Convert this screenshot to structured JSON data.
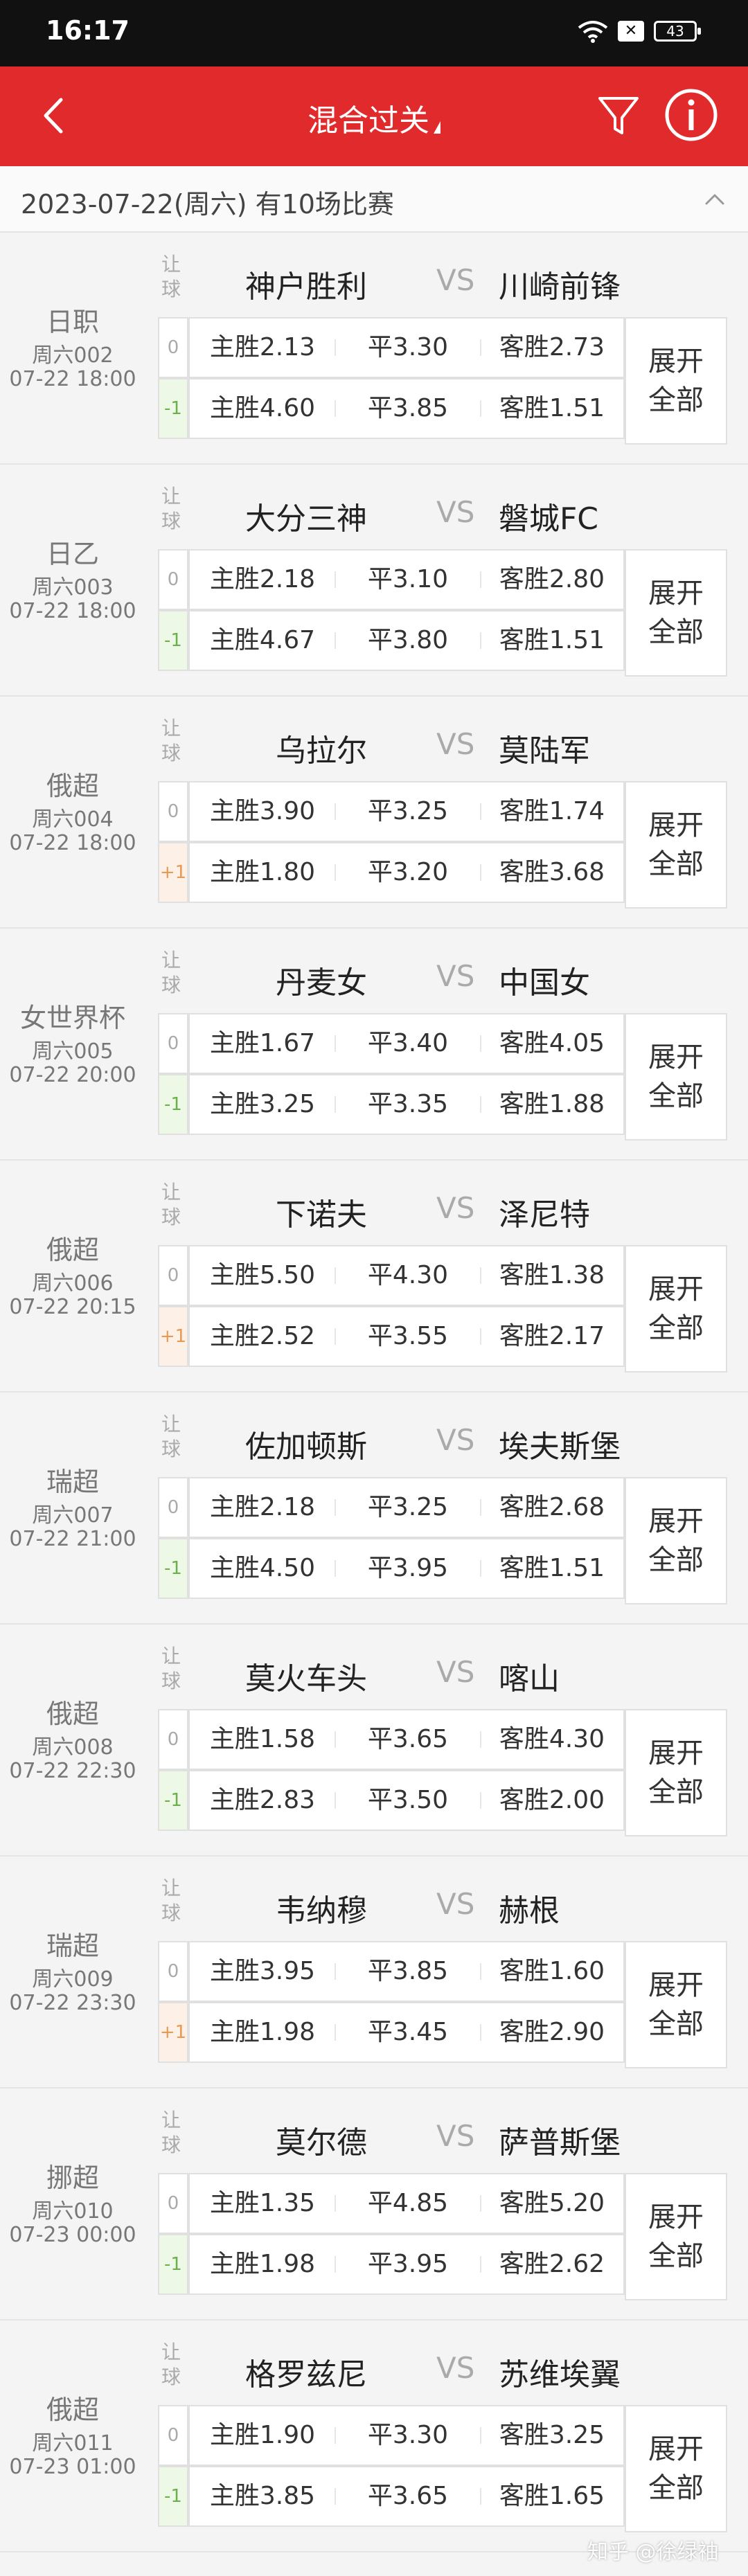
{
  "status_bar": {
    "time": "16:17",
    "sim": "✕",
    "battery": "43"
  },
  "header": {
    "title": "混合过关"
  },
  "date_bar": {
    "text": "2023-07-22(周六) 有10场比赛"
  },
  "labels": {
    "rangqiu": "让\n球",
    "vs": "VS",
    "expand": "展开\n全部"
  },
  "colors": {
    "header": "#e12a2c",
    "handicap_negative": "#6ab04c",
    "handicap_positive": "#e59a55"
  },
  "matches": [
    {
      "league": "日职",
      "num": "周六002",
      "datetime": "07-22 18:00",
      "home": "神户胜利",
      "away": "川崎前锋",
      "hcap0": "0",
      "hcap1": "-1",
      "hcap1_type": "neg",
      "r0": [
        "主胜2.13",
        "平3.30",
        "客胜2.73"
      ],
      "r1": [
        "主胜4.60",
        "平3.85",
        "客胜1.51"
      ]
    },
    {
      "league": "日乙",
      "num": "周六003",
      "datetime": "07-22 18:00",
      "home": "大分三神",
      "away": "磐城FC",
      "hcap0": "0",
      "hcap1": "-1",
      "hcap1_type": "neg",
      "r0": [
        "主胜2.18",
        "平3.10",
        "客胜2.80"
      ],
      "r1": [
        "主胜4.67",
        "平3.80",
        "客胜1.51"
      ]
    },
    {
      "league": "俄超",
      "num": "周六004",
      "datetime": "07-22 18:00",
      "home": "乌拉尔",
      "away": "莫陆军",
      "hcap0": "0",
      "hcap1": "+1",
      "hcap1_type": "pos",
      "r0": [
        "主胜3.90",
        "平3.25",
        "客胜1.74"
      ],
      "r1": [
        "主胜1.80",
        "平3.20",
        "客胜3.68"
      ]
    },
    {
      "league": "女世界杯",
      "num": "周六005",
      "datetime": "07-22 20:00",
      "home": "丹麦女",
      "away": "中国女",
      "hcap0": "0",
      "hcap1": "-1",
      "hcap1_type": "neg",
      "r0": [
        "主胜1.67",
        "平3.40",
        "客胜4.05"
      ],
      "r1": [
        "主胜3.25",
        "平3.35",
        "客胜1.88"
      ]
    },
    {
      "league": "俄超",
      "num": "周六006",
      "datetime": "07-22 20:15",
      "home": "下诺夫",
      "away": "泽尼特",
      "hcap0": "0",
      "hcap1": "+1",
      "hcap1_type": "pos",
      "r0": [
        "主胜5.50",
        "平4.30",
        "客胜1.38"
      ],
      "r1": [
        "主胜2.52",
        "平3.55",
        "客胜2.17"
      ]
    },
    {
      "league": "瑞超",
      "num": "周六007",
      "datetime": "07-22 21:00",
      "home": "佐加顿斯",
      "away": "埃夫斯堡",
      "hcap0": "0",
      "hcap1": "-1",
      "hcap1_type": "neg",
      "r0": [
        "主胜2.18",
        "平3.25",
        "客胜2.68"
      ],
      "r1": [
        "主胜4.50",
        "平3.95",
        "客胜1.51"
      ]
    },
    {
      "league": "俄超",
      "num": "周六008",
      "datetime": "07-22 22:30",
      "home": "莫火车头",
      "away": "喀山",
      "hcap0": "0",
      "hcap1": "-1",
      "hcap1_type": "neg",
      "r0": [
        "主胜1.58",
        "平3.65",
        "客胜4.30"
      ],
      "r1": [
        "主胜2.83",
        "平3.50",
        "客胜2.00"
      ]
    },
    {
      "league": "瑞超",
      "num": "周六009",
      "datetime": "07-22 23:30",
      "home": "韦纳穆",
      "away": "赫根",
      "hcap0": "0",
      "hcap1": "+1",
      "hcap1_type": "pos",
      "r0": [
        "主胜3.95",
        "平3.85",
        "客胜1.60"
      ],
      "r1": [
        "主胜1.98",
        "平3.45",
        "客胜2.90"
      ]
    },
    {
      "league": "挪超",
      "num": "周六010",
      "datetime": "07-23 00:00",
      "home": "莫尔德",
      "away": "萨普斯堡",
      "hcap0": "0",
      "hcap1": "-1",
      "hcap1_type": "neg",
      "r0": [
        "主胜1.35",
        "平4.85",
        "客胜5.20"
      ],
      "r1": [
        "主胜1.98",
        "平3.95",
        "客胜2.62"
      ]
    },
    {
      "league": "俄超",
      "num": "周六011",
      "datetime": "07-23 01:00",
      "home": "格罗兹尼",
      "away": "苏维埃翼",
      "hcap0": "0",
      "hcap1": "-1",
      "hcap1_type": "neg",
      "r0": [
        "主胜1.90",
        "平3.30",
        "客胜3.25"
      ],
      "r1": [
        "主胜3.85",
        "平3.65",
        "客胜1.65"
      ]
    }
  ],
  "watermark": "知乎 @徐绿袖"
}
